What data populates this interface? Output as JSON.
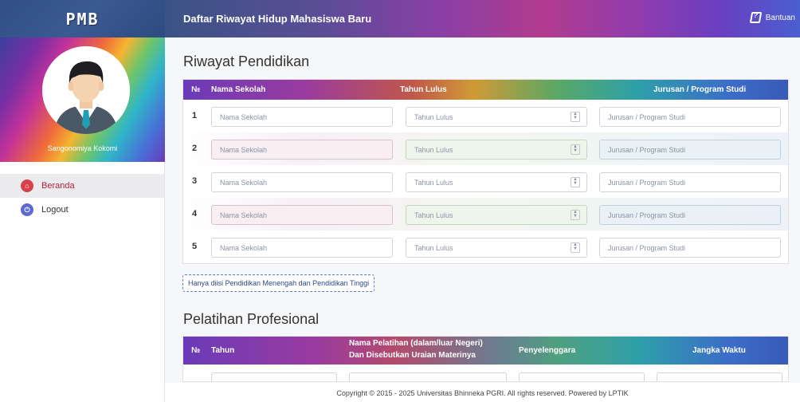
{
  "header": {
    "brand": "PMB",
    "title": "Daftar Riwayat Hidup Mahasiswa Baru",
    "help_label": "Bantuan"
  },
  "sidebar": {
    "user_name": "Sangonomiya Kokomi",
    "items": [
      {
        "label": "Beranda",
        "icon": "home-icon",
        "active": true
      },
      {
        "label": "Logout",
        "icon": "power-icon",
        "active": false
      }
    ]
  },
  "pendidikan": {
    "title": "Riwayat Pendidikan",
    "columns": [
      "№",
      "Nama Sekolah",
      "Tahun Lulus",
      "Jurusan / Program Studi"
    ],
    "rows": [
      {
        "no": "1",
        "nama_placeholder": "Nama Sekolah",
        "tahun_placeholder": "Tahun Lulus",
        "jurusan_placeholder": "Jurusan / Program Studi"
      },
      {
        "no": "2",
        "nama_placeholder": "Nama Sekolah",
        "tahun_placeholder": "Tahun Lulus",
        "jurusan_placeholder": "Jurusan / Program Studi"
      },
      {
        "no": "3",
        "nama_placeholder": "Nama Sekolah",
        "tahun_placeholder": "Tahun Lulus",
        "jurusan_placeholder": "Jurusan / Program Studi"
      },
      {
        "no": "4",
        "nama_placeholder": "Nama Sekolah",
        "tahun_placeholder": "Tahun Lulus",
        "jurusan_placeholder": "Jurusan / Program Studi"
      },
      {
        "no": "5",
        "nama_placeholder": "Nama Sekolah",
        "tahun_placeholder": "Tahun Lulus",
        "jurusan_placeholder": "Jurusan / Program Studi"
      }
    ],
    "note": "Hanya diisi Pendidikan Menengah dan Pendidikan Tinggi"
  },
  "pelatihan": {
    "title": "Pelatihan Profesional",
    "columns": {
      "no": "№",
      "tahun": "Tahun",
      "nama_line1": "Nama Pelatihan (dalam/luar Negeri)",
      "nama_line2": "Dan Disebutkan Uraian Materinya",
      "penyelenggara": "Penyelenggara",
      "jangka": "Jangka Waktu"
    }
  },
  "footer": {
    "text": "Copyright © 2015 - 2025 Universitas Bhinneka PGRI. All rights reserved. Powered by LPTIK"
  }
}
